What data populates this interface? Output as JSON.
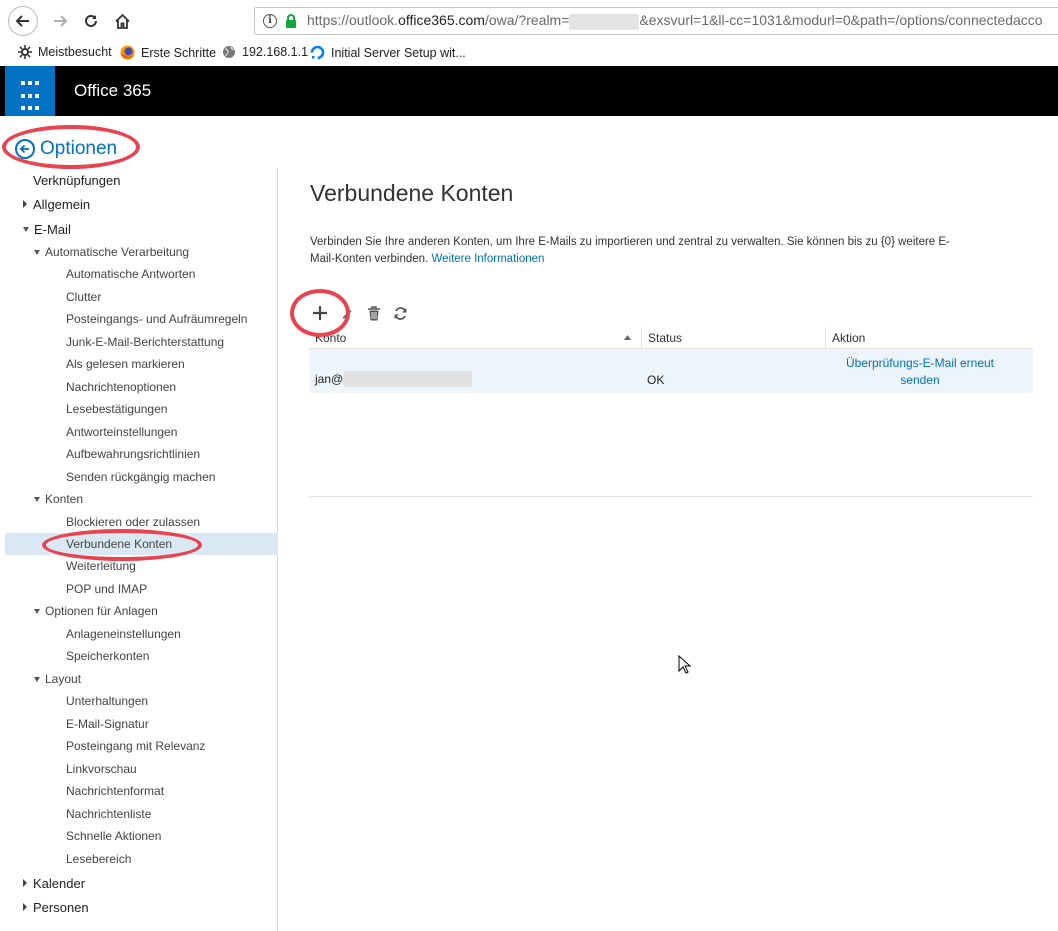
{
  "browser": {
    "url_prefix": "https://outlook.",
    "url_host": "office365.com",
    "url_path_1": "/owa/?realm=",
    "url_path_2": "&exsvurl=1&ll-cc=1031&modurl=0&path=/options/connectedacco",
    "bookmarks": [
      {
        "label": "Meistbesucht",
        "icon": "gear-icon"
      },
      {
        "label": "Erste Schritte",
        "icon": "firefox-icon"
      },
      {
        "label": "192.168.1.1",
        "icon": "globe-icon"
      },
      {
        "label": "Initial Server Setup wit...",
        "icon": "digitalocean-icon"
      }
    ]
  },
  "app": {
    "title": "Office 365"
  },
  "options": {
    "back_label": "Optionen"
  },
  "nav": [
    {
      "label": "Verknüpfungen",
      "level": 0,
      "arrow": "none"
    },
    {
      "label": "Allgemein",
      "level": 0,
      "arrow": "collapsed"
    },
    {
      "label": "E-Mail",
      "level": 0,
      "arrow": "expanded"
    },
    {
      "label": "Automatische Verarbeitung",
      "level": 1,
      "arrow": "expanded"
    },
    {
      "label": "Automatische Antworten",
      "level": 2
    },
    {
      "label": "Clutter",
      "level": 2
    },
    {
      "label": "Posteingangs- und Aufräumregeln",
      "level": 2
    },
    {
      "label": "Junk-E-Mail-Berichterstattung",
      "level": 2
    },
    {
      "label": "Als gelesen markieren",
      "level": 2
    },
    {
      "label": "Nachrichtenoptionen",
      "level": 2
    },
    {
      "label": "Lesebestätigungen",
      "level": 2
    },
    {
      "label": "Antworteinstellungen",
      "level": 2
    },
    {
      "label": "Aufbewahrungsrichtlinien",
      "level": 2
    },
    {
      "label": "Senden rückgängig machen",
      "level": 2
    },
    {
      "label": "Konten",
      "level": 1,
      "arrow": "expanded"
    },
    {
      "label": "Blockieren oder zulassen",
      "level": 2
    },
    {
      "label": "Verbundene Konten",
      "level": 2,
      "selected": true
    },
    {
      "label": "Weiterleitung",
      "level": 2
    },
    {
      "label": "POP und IMAP",
      "level": 2
    },
    {
      "label": "Optionen für Anlagen",
      "level": 1,
      "arrow": "expanded"
    },
    {
      "label": "Anlageneinstellungen",
      "level": 2
    },
    {
      "label": "Speicherkonten",
      "level": 2
    },
    {
      "label": "Layout",
      "level": 1,
      "arrow": "expanded"
    },
    {
      "label": "Unterhaltungen",
      "level": 2
    },
    {
      "label": "E-Mail-Signatur",
      "level": 2
    },
    {
      "label": "Posteingang mit Relevanz",
      "level": 2
    },
    {
      "label": "Linkvorschau",
      "level": 2
    },
    {
      "label": "Nachrichtenformat",
      "level": 2
    },
    {
      "label": "Nachrichtenliste",
      "level": 2
    },
    {
      "label": "Schnelle Aktionen",
      "level": 2
    },
    {
      "label": "Lesebereich",
      "level": 2
    },
    {
      "label": "Kalender",
      "level": 0,
      "arrow": "collapsed"
    },
    {
      "label": "Personen",
      "level": 0,
      "arrow": "collapsed"
    }
  ],
  "main": {
    "title": "Verbundene Konten",
    "description": "Verbinden Sie Ihre anderen Konten, um Ihre E-Mails zu importieren und zentral zu verwalten. Sie können bis zu {0} weitere E-Mail-Konten verbinden.",
    "more_info": "Weitere Informationen",
    "toolbar": [
      {
        "name": "add-button",
        "icon": "plus-icon"
      },
      {
        "name": "edit-button",
        "icon": "pencil-icon"
      },
      {
        "name": "delete-button",
        "icon": "trash-icon"
      },
      {
        "name": "refresh-button",
        "icon": "refresh-icon"
      }
    ],
    "columns": [
      "Konto",
      "Status",
      "Aktion"
    ],
    "rows": [
      {
        "account": "jan@",
        "status": "OK",
        "action": "Überprüfungs-E-Mail erneut senden"
      }
    ]
  }
}
